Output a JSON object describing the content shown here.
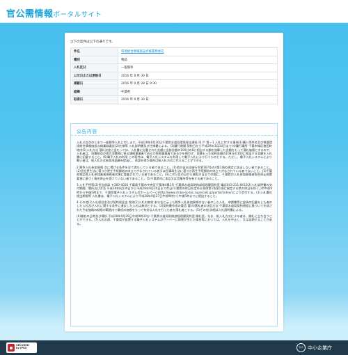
{
  "header": {
    "title_main": "官公需情報",
    "title_sub": "ポータルサイト"
  },
  "intro": "以下の案件は以下の通りです。",
  "info_table": [
    {
      "key": "件名",
      "value": "環境総合情報施設点検業務委託",
      "is_link": true
    },
    {
      "key": "種別",
      "value": "物品",
      "is_link": false
    },
    {
      "key": "入札区分",
      "value": "一般競争",
      "is_link": false
    },
    {
      "key": "公示日または更新日",
      "value": "2016 年 8 月 30 日",
      "is_link": false
    },
    {
      "key": "掲載日",
      "value": "2016 年 9 月 28 日 9:30",
      "is_link": false
    },
    {
      "key": "組織",
      "value": "千葉県",
      "is_link": false
    },
    {
      "key": "取得日",
      "value": "2016 年 9 月 30 日",
      "is_link": false
    }
  ],
  "notice": {
    "title": "公告内容",
    "paragraphs": [
      "入札公告次のとおり一般競争入札に付します。平成28年8月30日千葉県水道局環境保全課長 同 戸 第一1 入札に付する事項(1)購入等件名及び数量環境総合情報施設点検業務委託(2)仕様等 入札説明書及び仕様書による。(3)履行期間 契約日から平成29年3月10日まで(4)履行場所 千葉市緑区誉田町地内(5)入札方法 落札決定に当たっては、入札書に記載された金額に当該金額の100分の8に相当する額を加算した金額をもって落札価格とするので、入札者は、消費税及び地方消費税に係る課税事業者であるか免税事業者であるかを問わず、見積もった契約金額の108分の100に相当する金額を入札書に記載すること。(6)電子入札の利用 この案件は、電子入札システムを利用して電子入札により行うものとする。ただし、電子入札システムにより難い者は、紙入札方式参加承諾願を提出し、承認を得た場合は紙入札方式に代えることができる。",
      "2 競争入札参加資格 次に掲げる条件を全て満たしている者であること。(1)地方自治法施行令第167条の4第1項の規定に該当しない者であること。(2)会社更生法に基づき更生手続開始の申立てがなされている者又は民事再生法に基づき再生手続開始の申立てがなされている者でないこと。(3)千葉県物品等入札参加業者資格者名簿に登載されている者であること。(4)この公告の日から開札の日までの間に、千葉県の入札参加資格者指名停止措置要領に基づく指名停止を受けていない者であること。(5)千葉県内に本店又は営業所等を有する者であること。",
      "3 入札手続等(1)担当部局 〒260-0026 千葉県千葉市中央区千葉港4番1号 千葉県水道局財務部経理課契約室 電話043-211-8415(2)入札説明書の交付期間、場所及び方法 平成28年8月30日から平成28年9月20日までの日(千葉県の休日を定める条例第1条第1項に規定する県の休日を除く。)の午前9時から午後5時まで、千葉県電子入札システムのホームページ(http://www.chiba-ep-bis.supercals.jp/portal/index/)により交付する。(3)入札書の提出期限等 入札書は、電子入札システムにより平成28年9月27日午前9時から午後5時までに提出すること。",
      "4 その他(1)入札保証金及び契約保証金 免除(2)入札の無効 本公告に示した競争入札参加資格のない者のした入札、申請書等に虚偽の記載をした者のした入札及び入札に関する条件に違反した入札は無効とする。(3)契約書作成の要否 要(4)落札者の決定方法 千葉県水道局契約規程に基づいて作成された予定価格の制限の範囲内で最低の価格をもって有効な入札を行った者を落札者とする。(5)その他 詳細は入札説明書による。",
      "(6)開札の日時及び場所 平成28年9月28日午前9時30分 千葉県水道局財務部経理課契約室 開札室。なお、紙入札方式による者は、開札に立ち会うことができる。(7)入札の際、千葉県が設置する電子入札システムのサーバーに障害が生じた場合等においては、入札を中止し、又は延期することがある。"
    ]
  }
}
